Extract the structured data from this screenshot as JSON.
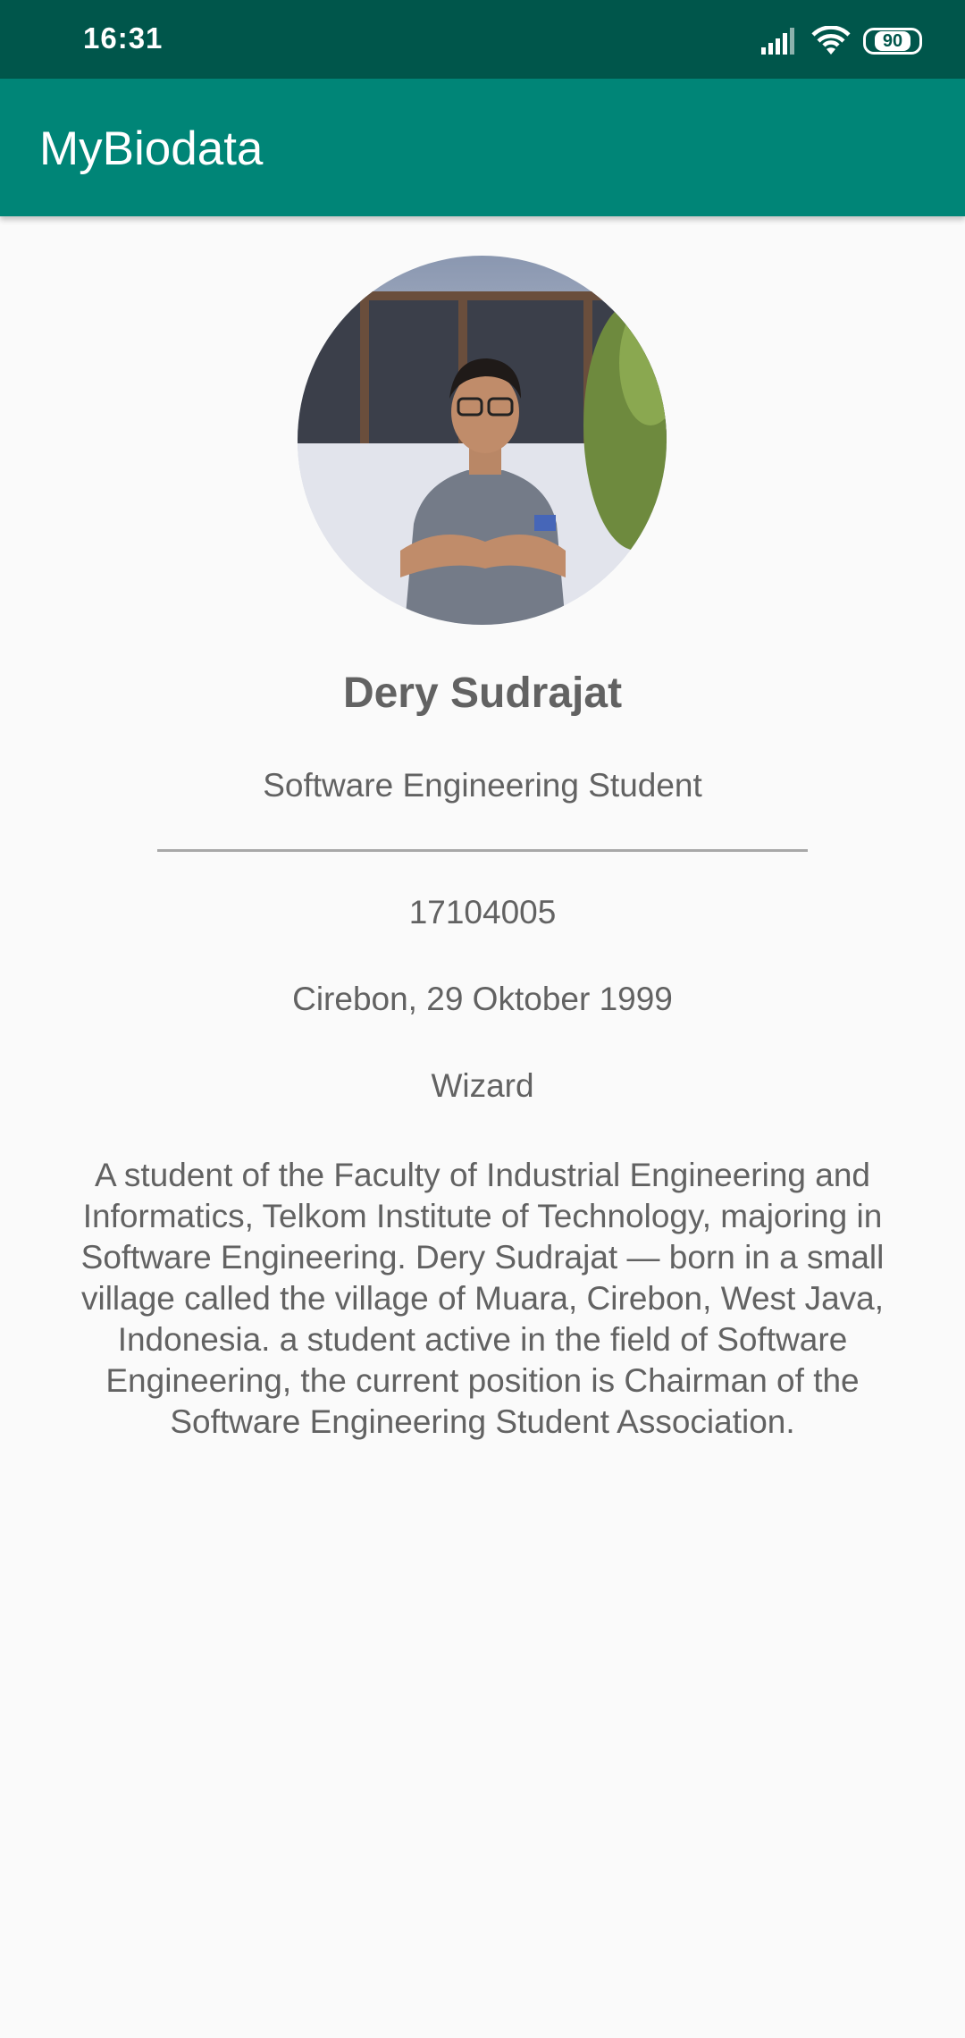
{
  "status_bar": {
    "time": "16:31",
    "battery": "90"
  },
  "app_bar": {
    "title": "MyBiodata"
  },
  "profile": {
    "name": "Dery Sudrajat",
    "role": "Software Engineering Student",
    "student_id": "17104005",
    "birth": "Cirebon, 29 Oktober 1999",
    "hobby": "Wizard",
    "bio": "A student of the Faculty of Industrial Engineering and Informatics, Telkom Institute of Technology, majoring in Software Engineering. Dery Sudrajat — born in a small village called the village of Muara, Cirebon, West Java, Indonesia. a student active in the field of Software Engineering, the current position is Chairman of the Software Engineering Student Association."
  },
  "colors": {
    "status_bar": "#00564b",
    "app_bar": "#008577",
    "text": "#626262",
    "background": "#fafafa"
  },
  "icons": [
    "signal-icon",
    "wifi-icon",
    "battery-icon"
  ]
}
